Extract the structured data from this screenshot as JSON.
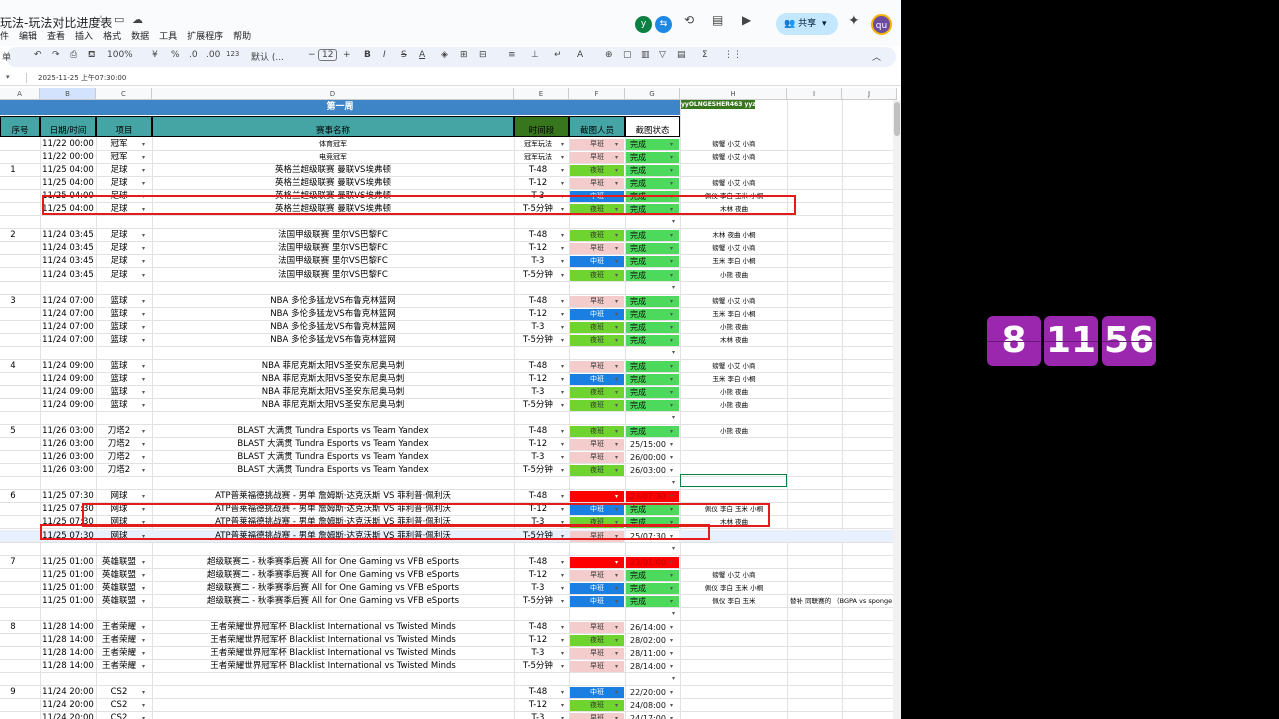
{
  "app": {
    "title": "玩法-玩法对比进度表",
    "menus": [
      "件",
      "编辑",
      "查看",
      "插入",
      "格式",
      "数据",
      "工具",
      "扩展程序",
      "帮助"
    ],
    "avatar1": "y",
    "avatar2": "qu",
    "share": "共享"
  },
  "toolbar": {
    "zoom": "100%",
    "currency": "¥",
    "percent": "%",
    "dec_minus": ".0",
    "dec_plus": ".00",
    "fmt123": "123",
    "font": "默认 (...",
    "fontsize": "12",
    "bold": "B",
    "italic": "I",
    "strike": "S",
    "textA": "A",
    "mode": "单"
  },
  "formula": {
    "value": "2025-11-25 上午07:30:00"
  },
  "columns": [
    "A",
    "B",
    "C",
    "D",
    "E",
    "F",
    "G",
    "H",
    "I",
    "J"
  ],
  "week": "第一周",
  "tag": "yyOLNGESHER463 yyzx",
  "headers": {
    "no": "序号",
    "date": "日期/时间",
    "item": "项目",
    "name": "赛事名称",
    "slot": "时间段",
    "person": "截图人员",
    "status": "截图状态"
  },
  "rows": [
    {
      "no": "",
      "date": "11/22 00:00",
      "item": "冠军",
      "name": "体育冠军",
      "slot": "冠军玩法",
      "person": "早班",
      "pc": "#f4cccc",
      "status": "完成",
      "sc": "#4dd95b",
      "h": "螃蟹 小艾 小商",
      "small": true
    },
    {
      "no": "",
      "date": "11/22 00:00",
      "item": "冠军",
      "name": "电竞冠军",
      "slot": "冠军玩法",
      "person": "早班",
      "pc": "#f4cccc",
      "status": "完成",
      "sc": "#4dd95b",
      "h": "螃蟹 小艾 小商",
      "small": true
    },
    {
      "no": "1",
      "date": "11/25 04:00",
      "item": "足球",
      "name": "英格兰超级联赛 曼联VS埃弗顿",
      "slot": "T-48",
      "person": "夜班",
      "pc": "#6fd42f",
      "status": "完成",
      "sc": "#4dd95b",
      "h": ""
    },
    {
      "no": "",
      "date": "11/25 04:00",
      "item": "足球",
      "name": "英格兰超级联赛 曼联VS埃弗顿",
      "slot": "T-12",
      "person": "早班",
      "pc": "#f4cccc",
      "status": "完成",
      "sc": "#4dd95b",
      "h": "螃蟹 小艾 小商"
    },
    {
      "no": "",
      "date": "11/25 04:00",
      "item": "足球",
      "name": "英格兰超级联赛 曼联VS埃弗顿",
      "slot": "T-3",
      "person": "中班",
      "pc": "#1a7fe0",
      "status": "完成",
      "sc": "#4dd95b",
      "h": "佩仪 李白 玉米 小桐"
    },
    {
      "no": "",
      "date": "11/25 04:00",
      "item": "足球",
      "name": "英格兰超级联赛 曼联VS埃弗顿",
      "slot": "T-5分钟",
      "person": "夜班",
      "pc": "#6fd42f",
      "status": "完成",
      "sc": "#4dd95b",
      "h": "木林 夜曲"
    },
    {
      "blank": true
    },
    {
      "no": "2",
      "date": "11/24 03:45",
      "item": "足球",
      "name": "法国甲级联赛 里尔VS巴黎FC",
      "slot": "T-48",
      "person": "夜班",
      "pc": "#6fd42f",
      "status": "完成",
      "sc": "#4dd95b",
      "h": "木林 夜曲 小桐"
    },
    {
      "no": "",
      "date": "11/24 03:45",
      "item": "足球",
      "name": "法国甲级联赛 里尔VS巴黎FC",
      "slot": "T-12",
      "person": "早班",
      "pc": "#f4cccc",
      "status": "完成",
      "sc": "#4dd95b",
      "h": "螃蟹 小艾 小商"
    },
    {
      "no": "",
      "date": "11/24 03:45",
      "item": "足球",
      "name": "法国甲级联赛 里尔VS巴黎FC",
      "slot": "T-3",
      "person": "中班",
      "pc": "#1a7fe0",
      "status": "完成",
      "sc": "#4dd95b",
      "h": "玉米 李白 小桐"
    },
    {
      "no": "",
      "date": "11/24 03:45",
      "item": "足球",
      "name": "法国甲级联赛 里尔VS巴黎FC",
      "slot": "T-5分钟",
      "person": "夜班",
      "pc": "#6fd42f",
      "status": "完成",
      "sc": "#4dd95b",
      "h": "小熊 夜曲"
    },
    {
      "blank": true
    },
    {
      "no": "3",
      "date": "11/24 07:00",
      "item": "篮球",
      "name": "NBA 多伦多猛龙VS布鲁克林篮网",
      "slot": "T-48",
      "person": "早班",
      "pc": "#f4cccc",
      "status": "完成",
      "sc": "#4dd95b",
      "h": "螃蟹 小艾 小商"
    },
    {
      "no": "",
      "date": "11/24 07:00",
      "item": "篮球",
      "name": "NBA 多伦多猛龙VS布鲁克林篮网",
      "slot": "T-12",
      "person": "中班",
      "pc": "#1a7fe0",
      "status": "完成",
      "sc": "#4dd95b",
      "h": "玉米 李白 小桐"
    },
    {
      "no": "",
      "date": "11/24 07:00",
      "item": "篮球",
      "name": "NBA 多伦多猛龙VS布鲁克林篮网",
      "slot": "T-3",
      "person": "夜班",
      "pc": "#6fd42f",
      "status": "完成",
      "sc": "#4dd95b",
      "h": "小熊 夜曲"
    },
    {
      "no": "",
      "date": "11/24 07:00",
      "item": "篮球",
      "name": "NBA 多伦多猛龙VS布鲁克林篮网",
      "slot": "T-5分钟",
      "person": "夜班",
      "pc": "#6fd42f",
      "status": "完成",
      "sc": "#4dd95b",
      "h": "木林 夜曲"
    },
    {
      "blank": true
    },
    {
      "no": "4",
      "date": "11/24 09:00",
      "item": "篮球",
      "name": "NBA 菲尼克斯太阳VS圣安东尼奥马刺",
      "slot": "T-48",
      "person": "早班",
      "pc": "#f4cccc",
      "status": "完成",
      "sc": "#4dd95b",
      "h": "螃蟹 小艾 小商"
    },
    {
      "no": "",
      "date": "11/24 09:00",
      "item": "篮球",
      "name": "NBA 菲尼克斯太阳VS圣安东尼奥马刺",
      "slot": "T-12",
      "person": "中班",
      "pc": "#1a7fe0",
      "status": "完成",
      "sc": "#4dd95b",
      "h": "玉米 李白 小桐"
    },
    {
      "no": "",
      "date": "11/24 09:00",
      "item": "篮球",
      "name": "NBA 菲尼克斯太阳VS圣安东尼奥马刺",
      "slot": "T-3",
      "person": "夜班",
      "pc": "#6fd42f",
      "status": "完成",
      "sc": "#4dd95b",
      "h": "小熊 夜曲"
    },
    {
      "no": "",
      "date": "11/24 09:00",
      "item": "篮球",
      "name": "NBA 菲尼克斯太阳VS圣安东尼奥马刺",
      "slot": "T-5分钟",
      "person": "夜班",
      "pc": "#6fd42f",
      "status": "完成",
      "sc": "#4dd95b",
      "h": "小熊 夜曲"
    },
    {
      "blank": true
    },
    {
      "no": "5",
      "date": "11/26 03:00",
      "item": "刀塔2",
      "name": "BLAST 大满贯 Tundra Esports vs Team Yandex",
      "slot": "T-48",
      "person": "夜班",
      "pc": "#6fd42f",
      "status": "完成",
      "sc": "#4dd95b",
      "h": "小熊 夜曲"
    },
    {
      "no": "",
      "date": "11/26 03:00",
      "item": "刀塔2",
      "name": "BLAST 大满贯 Tundra Esports vs Team Yandex",
      "slot": "T-12",
      "person": "早班",
      "pc": "#f4cccc",
      "status": "25/15:00",
      "sc": "#ffffff",
      "h": ""
    },
    {
      "no": "",
      "date": "11/26 03:00",
      "item": "刀塔2",
      "name": "BLAST 大满贯 Tundra Esports vs Team Yandex",
      "slot": "T-3",
      "person": "早班",
      "pc": "#f4cccc",
      "status": "26/00:00",
      "sc": "#ffffff",
      "h": ""
    },
    {
      "no": "",
      "date": "11/26 03:00",
      "item": "刀塔2",
      "name": "BLAST 大满贯 Tundra Esports vs Team Yandex",
      "slot": "T-5分钟",
      "person": "夜班",
      "pc": "#6fd42f",
      "status": "26/03:00",
      "sc": "#ffffff",
      "h": ""
    },
    {
      "blank": true
    },
    {
      "no": "6",
      "date": "11/25 07:30",
      "item": "网球",
      "name": "ATP普莱福德挑战赛 - 男单 詹姆斯·达克沃斯 VS 菲利普·佩利沃",
      "slot": "T-48",
      "person": "",
      "pc": "#ff0000",
      "status": "23/07:30",
      "sc": "#ff0000",
      "h": ""
    },
    {
      "no": "",
      "date": "11/25 07:30",
      "item": "网球",
      "name": "ATP普莱福德挑战赛 - 男单 詹姆斯·达克沃斯 VS 菲利普·佩利沃",
      "slot": "T-12",
      "person": "中班",
      "pc": "#1a7fe0",
      "status": "完成",
      "sc": "#4dd95b",
      "h": "佩仪 李白 玉米 小桐"
    },
    {
      "no": "",
      "date": "11/25 07:30",
      "item": "网球",
      "name": "ATP普莱福德挑战赛 - 男单 詹姆斯·达克沃斯 VS 菲利普·佩利沃",
      "slot": "T-3",
      "person": "夜班",
      "pc": "#6fd42f",
      "status": "完成",
      "sc": "#4dd95b",
      "h": "木林 夜曲"
    },
    {
      "no": "",
      "date": "11/25 07:30",
      "item": "网球",
      "name": "ATP普莱福德挑战赛 - 男单 詹姆斯·达克沃斯 VS 菲利普·佩利沃",
      "slot": "T-5分钟",
      "person": "早班",
      "pc": "#f4cccc",
      "status": "25/07:30",
      "sc": "#ffffff",
      "h": "",
      "sel": true
    },
    {
      "blank": true
    },
    {
      "no": "7",
      "date": "11/25 01:00",
      "item": "英雄联盟",
      "name": "超级联赛二 - 秋季赛季后赛 All for One Gaming vs VFB eSports",
      "slot": "T-48",
      "person": "",
      "pc": "#ff0000",
      "status": "23/01:00",
      "sc": "#ff0000",
      "h": ""
    },
    {
      "no": "",
      "date": "11/25 01:00",
      "item": "英雄联盟",
      "name": "超级联赛二 - 秋季赛季后赛 All for One Gaming vs VFB eSports",
      "slot": "T-12",
      "person": "早班",
      "pc": "#f4cccc",
      "status": "完成",
      "sc": "#4dd95b",
      "h": "螃蟹 小艾 小商"
    },
    {
      "no": "",
      "date": "11/25 01:00",
      "item": "英雄联盟",
      "name": "超级联赛二 - 秋季赛季后赛 All for One Gaming vs VFB eSports",
      "slot": "T-3",
      "person": "中班",
      "pc": "#1a7fe0",
      "status": "完成",
      "sc": "#4dd95b",
      "h": "佩仪 李白 玉米 小桐"
    },
    {
      "no": "",
      "date": "11/25 01:00",
      "item": "英雄联盟",
      "name": "超级联赛二 - 秋季赛季后赛 All for One Gaming vs VFB eSports",
      "slot": "T-5分钟",
      "person": "中班",
      "pc": "#1a7fe0",
      "status": "完成",
      "sc": "#4dd95b",
      "h": "佩仪 李白 玉米",
      "extra": "替补 同联赛的 （BGPA vs sponge"
    },
    {
      "blank": true
    },
    {
      "no": "8",
      "date": "11/28 14:00",
      "item": "王者荣耀",
      "name": "王者荣耀世界冠军杯 Blacklist International vs Twisted Minds",
      "slot": "T-48",
      "person": "早班",
      "pc": "#f4cccc",
      "status": "26/14:00",
      "sc": "#ffffff",
      "h": ""
    },
    {
      "no": "",
      "date": "11/28 14:00",
      "item": "王者荣耀",
      "name": "王者荣耀世界冠军杯 Blacklist International vs Twisted Minds",
      "slot": "T-12",
      "person": "夜班",
      "pc": "#6fd42f",
      "status": "28/02:00",
      "sc": "#ffffff",
      "h": ""
    },
    {
      "no": "",
      "date": "11/28 14:00",
      "item": "王者荣耀",
      "name": "王者荣耀世界冠军杯 Blacklist International vs Twisted Minds",
      "slot": "T-3",
      "person": "早班",
      "pc": "#f4cccc",
      "status": "28/11:00",
      "sc": "#ffffff",
      "h": ""
    },
    {
      "no": "",
      "date": "11/28 14:00",
      "item": "王者荣耀",
      "name": "王者荣耀世界冠军杯 Blacklist International vs Twisted Minds",
      "slot": "T-5分钟",
      "person": "早班",
      "pc": "#f4cccc",
      "status": "28/14:00",
      "sc": "#ffffff",
      "h": ""
    },
    {
      "blank": true
    },
    {
      "no": "9",
      "date": "11/24 20:00",
      "item": "CS2",
      "name": "",
      "slot": "T-48",
      "person": "中班",
      "pc": "#1a7fe0",
      "status": "22/20:00",
      "sc": "#ffffff",
      "h": ""
    },
    {
      "no": "",
      "date": "11/24 20:00",
      "item": "CS2",
      "name": "",
      "slot": "T-12",
      "person": "夜班",
      "pc": "#6fd42f",
      "status": "24/08:00",
      "sc": "#ffffff",
      "h": ""
    },
    {
      "no": "",
      "date": "11/24 20:00",
      "item": "CS2",
      "name": "",
      "slot": "T-3",
      "person": "早班",
      "pc": "#f4cccc",
      "status": "24/17:00",
      "sc": "#ffffff",
      "h": ""
    }
  ],
  "clock": {
    "h": "8",
    "m": "11",
    "s": "56"
  }
}
